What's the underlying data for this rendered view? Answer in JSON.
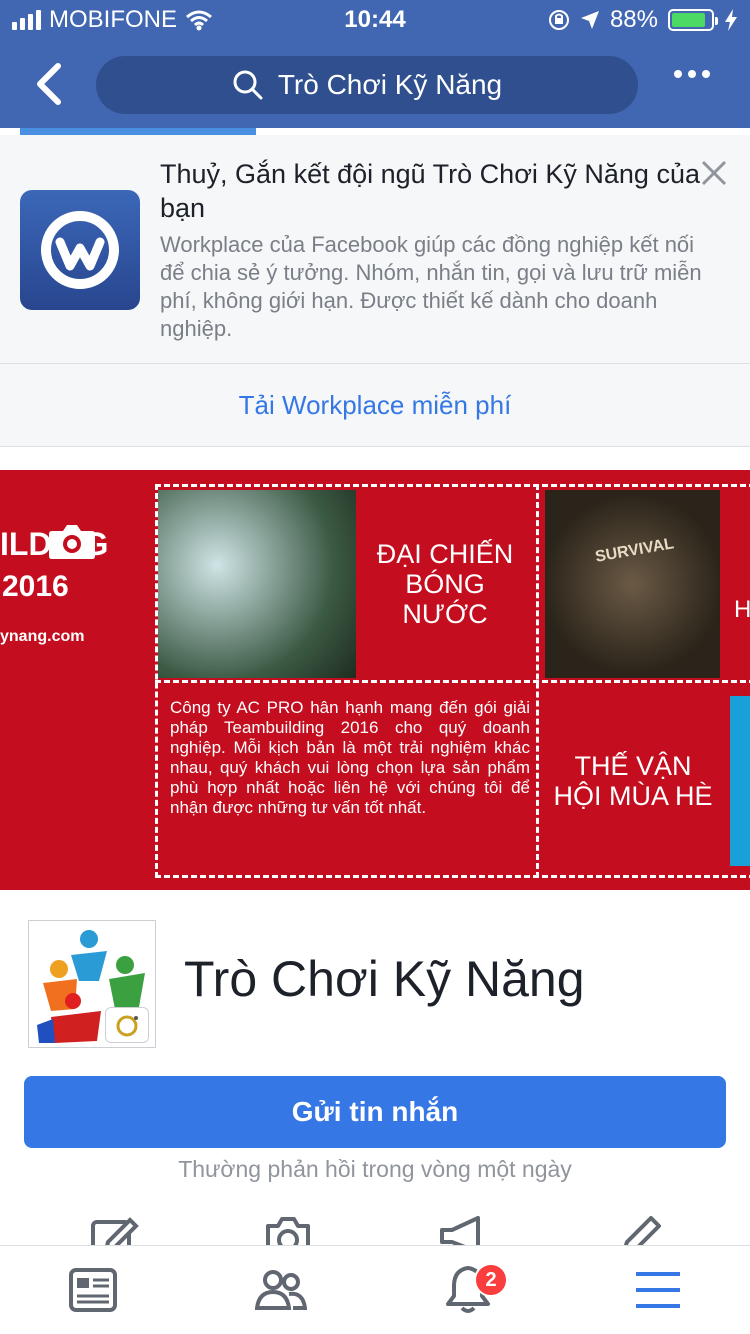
{
  "status_bar": {
    "carrier": "MOBIFONE",
    "time": "10:44",
    "battery_percent": "88%",
    "battery_level": 0.88
  },
  "nav": {
    "search_text": "Trò Chơi Kỹ Năng"
  },
  "promo": {
    "title": "Thuỷ, Gắn kết đội ngũ Trò Chơi Kỹ Năng của bạn",
    "description": "Workplace của Facebook giúp các đồng nghiệp kết nối để chia sẻ ý tưởng. Nhóm, nhắn tin, gọi và lưu trữ miễn phí, không giới hạn. Được thiết kế dành cho doanh nghiệp.",
    "cta": "Tải Workplace miễn phí"
  },
  "cover": {
    "brand": "ILDING",
    "year": "2016",
    "site": "ynang.com",
    "tile1": "ĐẠI CHIẾN BÓNG NƯỚC",
    "photo_label": "SURVIVAL",
    "copy": "Công ty AC PRO hân hạnh mang đến gói giải pháp Teambuilding 2016 cho quý doanh nghiệp. Mỗi kịch bản là một trải nghiệm khác nhau, quý khách vui lòng chọn lựa sản phẩm phù hợp nhất hoặc liên hệ với chúng tôi để nhận được những tư vấn tốt nhất.",
    "tile2": "THẾ VẬN HỘI MÙA HÈ",
    "edge_letter": "H"
  },
  "page": {
    "name": "Trò Chơi Kỹ Năng",
    "send_label": "Gửi tin nhắn",
    "response_note": "Thường phản hồi trong vòng một ngày"
  },
  "tabbar": {
    "notifications_badge": "2"
  },
  "colors": {
    "brand": "#4267b2",
    "primary_button": "#3578e5",
    "badge": "#fa3e3e",
    "cover_red": "#c40d1e"
  }
}
